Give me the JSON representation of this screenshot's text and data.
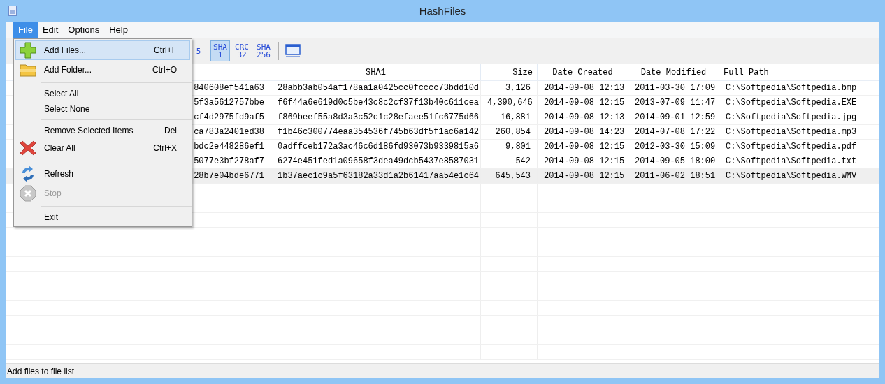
{
  "window": {
    "title": "HashFiles"
  },
  "menu_bar": [
    {
      "label": "File",
      "selected": true
    },
    {
      "label": "Edit",
      "selected": false
    },
    {
      "label": "Options",
      "selected": false
    },
    {
      "label": "Help",
      "selected": false
    }
  ],
  "toolbar": [
    {
      "kind": "hash",
      "line1": "5",
      "selected": false
    },
    {
      "kind": "hash",
      "line1": "SHA",
      "line2": "1",
      "selected": true
    },
    {
      "kind": "hash",
      "line1": "CRC",
      "line2": "32",
      "selected": false
    },
    {
      "kind": "hash",
      "line1": "SHA",
      "line2": "256",
      "selected": false
    },
    {
      "kind": "separator"
    },
    {
      "kind": "window"
    }
  ],
  "table": {
    "columns": [
      null,
      null,
      "SHA1",
      "Size",
      "Date Created",
      "Date Modified",
      "Full Path"
    ],
    "rows": [
      {
        "selected": false,
        "cells": [
          null,
          "840608ef541a63",
          "28abb3ab054af178aa1a0425cc0fcccc73bdd10d",
          "3,126",
          "2014-09-08 12:13",
          "2011-03-30 17:09",
          "C:\\Softpedia\\Softpedia.bmp"
        ]
      },
      {
        "selected": false,
        "cells": [
          null,
          "5f3a5612757bbe",
          "f6f44a6e619d0c5be43c8c2cf37f13b40c611cea",
          "4,390,646",
          "2014-09-08 12:15",
          "2013-07-09 11:47",
          "C:\\Softpedia\\Softpedia.EXE"
        ]
      },
      {
        "selected": false,
        "cells": [
          null,
          "cf4d2975fd9af5",
          "f869beef55a8d3a3c52c1c28efaee51fc6775d66",
          "16,881",
          "2014-09-08 12:13",
          "2014-09-01 12:59",
          "C:\\Softpedia\\Softpedia.jpg"
        ]
      },
      {
        "selected": false,
        "cells": [
          null,
          "ca783a2401ed38",
          "f1b46c300774eaa354536f745b63df5f1ac6a142",
          "260,854",
          "2014-09-08 14:23",
          "2014-07-08 17:22",
          "C:\\Softpedia\\Softpedia.mp3"
        ]
      },
      {
        "selected": false,
        "cells": [
          null,
          "bdc2e448286ef1",
          "0adffceb172a3ac46c6d186fd93073b9339815a6",
          "9,801",
          "2014-09-08 12:15",
          "2012-03-30 15:09",
          "C:\\Softpedia\\Softpedia.pdf"
        ]
      },
      {
        "selected": false,
        "cells": [
          null,
          "5077e3bf278af7",
          "6274e451fed1a09658f3dea49dcb5437e8587031",
          "542",
          "2014-09-08 12:15",
          "2014-09-05 18:00",
          "C:\\Softpedia\\Softpedia.txt"
        ]
      },
      {
        "selected": true,
        "cells": [
          null,
          "28b7e04bde6771",
          "1b37aec1c9a5f63182a33d1a2b61417aa54e1c64",
          "645,543",
          "2014-09-08 12:15",
          "2011-06-02 18:51",
          "C:\\Softpedia\\Softpedia.WMV"
        ]
      }
    ]
  },
  "file_menu": [
    {
      "kind": "item",
      "label": "Add Files...",
      "shortcut": "Ctrl+F",
      "selected": true,
      "disabled": false
    },
    {
      "kind": "item",
      "label": "Add Folder...",
      "shortcut": "Ctrl+O",
      "selected": false,
      "disabled": false
    },
    {
      "kind": "separator"
    },
    {
      "kind": "item",
      "label": "Select All",
      "selected": false,
      "disabled": false
    },
    {
      "kind": "item",
      "label": "Select None",
      "selected": false,
      "disabled": false
    },
    {
      "kind": "separator"
    },
    {
      "kind": "item",
      "label": "Remove Selected Items",
      "shortcut": "Del",
      "selected": false,
      "disabled": false
    },
    {
      "kind": "item",
      "label": "Clear All",
      "shortcut": "Ctrl+X",
      "selected": false,
      "disabled": false
    },
    {
      "kind": "separator"
    },
    {
      "kind": "item",
      "label": "Refresh",
      "selected": false,
      "disabled": false
    },
    {
      "kind": "item",
      "label": "Stop",
      "selected": false,
      "disabled": true
    },
    {
      "kind": "separator"
    },
    {
      "kind": "item",
      "label": "Exit",
      "selected": false,
      "disabled": false
    }
  ],
  "status_bar": "Add files to file list"
}
